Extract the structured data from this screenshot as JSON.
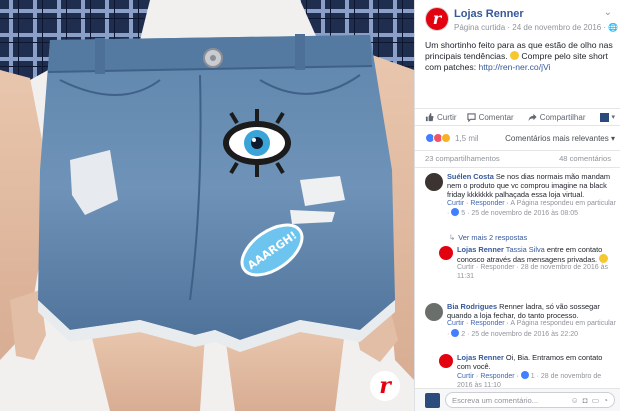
{
  "photo": {
    "brand_badge_letter": "r"
  },
  "page": {
    "name": "Lojas Renner",
    "meta": "Página curtida · 24 de novembro de 2016 · ",
    "logo_letter": "r"
  },
  "post": {
    "text": "Um shortinho feito para as que estão de olho nas principais tendências. ",
    "text2": " Compre pelo site short com patches: ",
    "link": "http://ren-ner.co/jVi"
  },
  "actions": {
    "like": "Curtir",
    "comment": "Comentar",
    "share": "Compartilhar"
  },
  "reactions": {
    "count": "1,5 mil",
    "relevance": "Comentários mais relevantes ▾"
  },
  "stats": {
    "shares": "23 compartilhamentos",
    "comments": "48 comentários"
  },
  "comments": [
    {
      "author": "Suélen Costa",
      "text": " Se nos dias normais mão mandam nem o produto que vc comprou imagine na black friday kkkkkkk palhaçada essa loja virtual.",
      "meta_1": "Curtir · Responder · ",
      "meta_2": "A Página respondeu em particular · ",
      "meta_3": " 5 · 25 de novembro de 2016 às 08:05"
    },
    {
      "more_replies": "Ver mais 2 respostas"
    },
    {
      "author": "Lojas Renner",
      "mention": " Tassia Silva",
      "text": " entre em contato conosco através das mensagens privadas. ",
      "meta": "Curtir · Responder · 28 de novembro de 2016 às 11:31"
    },
    {
      "author": "Bia Rodrigues",
      "text": " Renner ladra, só vão sossegar quando a loja fechar, do tanto processo.",
      "meta_1": "Curtir · Responder · ",
      "meta_2": "A Página respondeu em particular · ",
      "meta_3": " 2 · 25 de novembro de 2016 às 22:20"
    },
    {
      "author": "Lojas Renner",
      "text": " Oi, Bia. Entramos em contato com você.",
      "meta": "Curtir · Responder · ",
      "meta_2": " 1 · 28 de novembro de 2016 às 11:10"
    }
  ],
  "footer": {
    "placeholder": "Escreva um comentário..."
  },
  "colors": {
    "facebook_blue": "#365899",
    "brand_red": "#e3000f",
    "denim": "#5a7fa6"
  }
}
